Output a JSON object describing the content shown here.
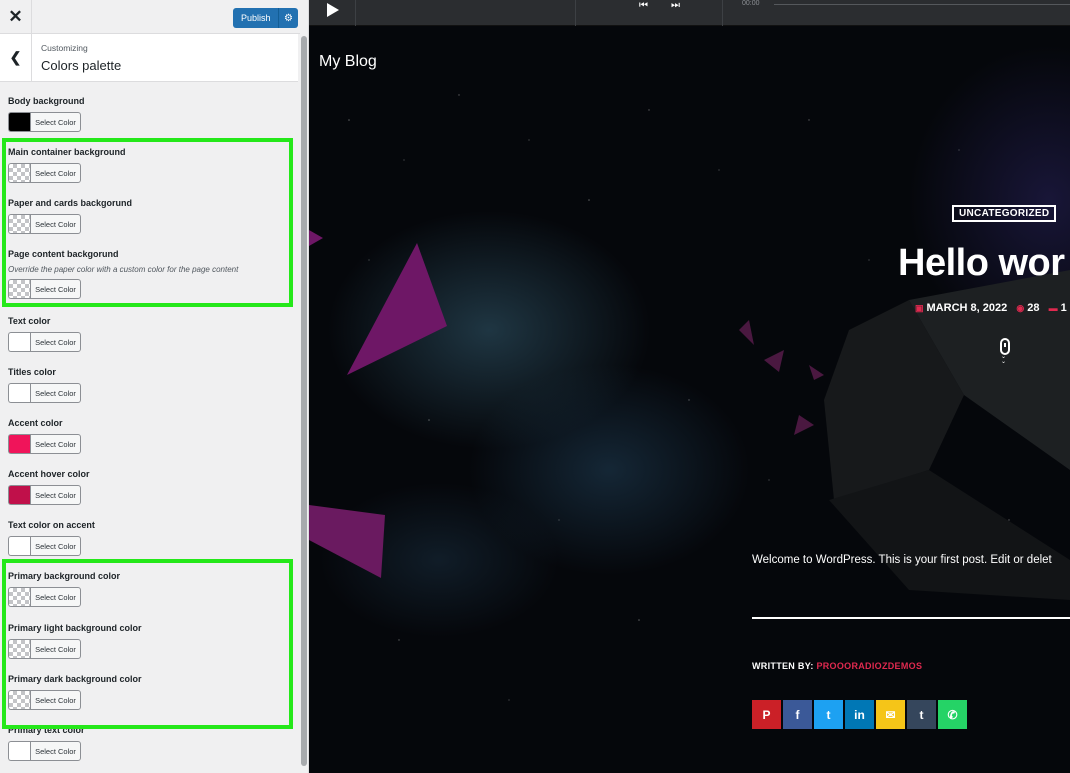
{
  "app": {
    "close_icon": "close-icon",
    "publish_label": "Publish",
    "publish_icon": "gear-icon"
  },
  "panel": {
    "subtitle": "Customizing",
    "title": "Colors palette",
    "back_icon": "chevron-left-icon"
  },
  "controls": [
    {
      "title": "Body background",
      "button": "Select Color",
      "color": "#000000"
    },
    {
      "title": "Main container background",
      "button": "Select Color",
      "color": "transparent"
    },
    {
      "title": "Paper and cards backgorund",
      "button": "Select Color",
      "color": "transparent"
    },
    {
      "title": "Page content backgorund",
      "description": "Override the paper color with a custom color for the page content",
      "button": "Select Color",
      "color": "transparent"
    },
    {
      "title": "Text color",
      "button": "Select Color",
      "color": "#ffffff"
    },
    {
      "title": "Titles color",
      "button": "Select Color",
      "color": "#ffffff"
    },
    {
      "title": "Accent color",
      "button": "Select Color",
      "color": "#f0145a"
    },
    {
      "title": "Accent hover color",
      "button": "Select Color",
      "color": "#c0104a"
    },
    {
      "title": "Text color on accent",
      "button": "Select Color",
      "color": "#ffffff"
    },
    {
      "title": "Primary background color",
      "button": "Select Color",
      "color": "transparent"
    },
    {
      "title": "Primary light background color",
      "button": "Select Color",
      "color": "transparent"
    },
    {
      "title": "Primary dark background color",
      "button": "Select Color",
      "color": "transparent"
    },
    {
      "title": "Primary text color",
      "button": "Select Color",
      "color": "#ffffff"
    }
  ],
  "highlight_color": "#25e81a",
  "preview": {
    "player": {
      "time": "00:00",
      "play_icon": "play-icon",
      "prev_icon": "skip-back-icon",
      "next_icon": "skip-forward-icon"
    },
    "site_title": "My Blog",
    "category": "UNCATEGORIZED",
    "post_title": "Hello wor",
    "date": "MARCH 8, 2022",
    "views": "28",
    "comments": "1",
    "excerpt": "Welcome to WordPress. This is your first post. Edit or delet",
    "written_by_label": "WRITTEN BY:",
    "author": "PROOORADIOZDEMOS",
    "accent": "#e0294f",
    "share": [
      {
        "name": "pinterest",
        "glyph": "P",
        "color": "#cb2027"
      },
      {
        "name": "facebook",
        "glyph": "f",
        "color": "#3b5998"
      },
      {
        "name": "twitter",
        "glyph": "t",
        "color": "#1da1f2"
      },
      {
        "name": "linkedin",
        "glyph": "in",
        "color": "#0077b5"
      },
      {
        "name": "email",
        "glyph": "✉",
        "color": "#f5c518"
      },
      {
        "name": "tumblr",
        "glyph": "t",
        "color": "#35465c"
      },
      {
        "name": "whatsapp",
        "glyph": "✆",
        "color": "#25d366"
      }
    ]
  }
}
